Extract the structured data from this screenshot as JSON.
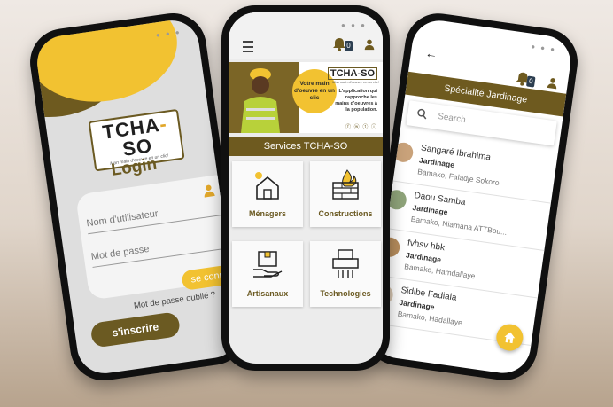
{
  "app": {
    "logo_text": "TCHA",
    "logo_text2": "SO",
    "logo_dash": "-",
    "tagline": "Mon main d'oeuvre en un clic!"
  },
  "login": {
    "title": "Login",
    "username_placeholder": "Nom d'utilisateur",
    "password_placeholder": "Mot de passe",
    "forgot_password": "Mot de passe oublié ?",
    "signup_button": "s'inscrire",
    "login_button": "se conn"
  },
  "home": {
    "notifications_count": "0",
    "banner": {
      "circle_text": "Votre main d'oeuvre en un clic",
      "logo": "TCHA-SO",
      "logo_tag": "Mon main d'oeuvre en un clic!",
      "text": "L'application qui rapproche les mains d'oeuvres à la population."
    },
    "services_title": "Services TCHA-SO",
    "services": [
      {
        "label": "Ménagers",
        "icon": "house-sun-icon"
      },
      {
        "label": "Constructions",
        "icon": "brick-wall-fire-icon"
      },
      {
        "label": "Artisanaux",
        "icon": "hand-box-icon"
      },
      {
        "label": "Technologies",
        "icon": "shredder-icon"
      }
    ]
  },
  "specialty": {
    "notifications_count": "0",
    "title": "Spécialité Jardinage",
    "search_placeholder": "Search",
    "workers": [
      {
        "name": "Sangaré Ibrahima",
        "specialty": "Jardinage",
        "address": "Bamako, Faladje Sokoro"
      },
      {
        "name": "Daou Samba",
        "specialty": "Jardinage",
        "address": "Bamako, Niamana ATTBou..."
      },
      {
        "name": "fvhsv hbk",
        "specialty": "Jardinage",
        "address": "Bamako, Hamdallaye"
      },
      {
        "name": "Sidibe Fadiala",
        "specialty": "Jardinage",
        "address": "Bamako, Hadallaye"
      }
    ]
  },
  "colors": {
    "brand_brown": "#6e5a1f",
    "brand_yellow": "#f2c231"
  }
}
